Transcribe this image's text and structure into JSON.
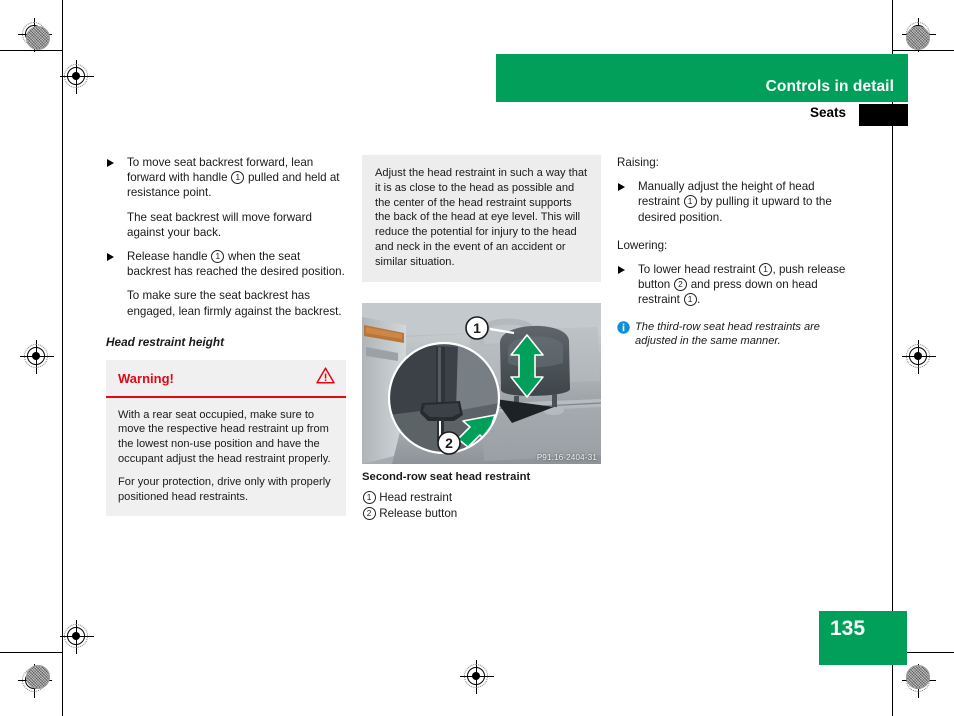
{
  "header": {
    "title": "Controls in detail",
    "section": "Seats"
  },
  "footer": {
    "page_number": "135"
  },
  "colors": {
    "brand_green": "#00a05a",
    "warning_red": "#e30613",
    "info_blue": "#0e8fd6",
    "note_gray": "#ededed",
    "warning_gray": "#f0f0f0"
  },
  "left_column": {
    "bullet1": "To move seat backrest forward, lean forward with handle ① pulled and held at resistance point.",
    "bullet1_pre": "To move seat backrest forward, lean forward with handle ",
    "bullet1_post": " pulled and held at resistance point.",
    "note1": "The seat backrest will move forward against your back.",
    "bullet2_pre": "Release handle ",
    "bullet2_post": " when the seat backrest has reached the desired position.",
    "note2": "To make sure the seat backrest has engaged, lean firmly against the backrest.",
    "subhead": "Head restraint height",
    "warning": {
      "label": "Warning!",
      "icon": "warning-triangle-icon",
      "paragraph1": "With a rear seat occupied, make sure to move the respective head restraint up from the lowest non-use position and have the occupant adjust the head restraint properly.",
      "paragraph2": "For your protection, drive only with properly positioned head restraints."
    }
  },
  "middle_column": {
    "note_box": "Adjust the head restraint in such a way that it is as close to the head as possible and the center of the head restraint supports the back of the head at eye level. This will reduce the potential for injury to the head and neck in the event of an accident or similar situation.",
    "figure": {
      "reference_code": "P91.16-2404-31",
      "callout_1": "1",
      "callout_2": "2",
      "caption": "Second-row seat head restraint",
      "legend": [
        {
          "num": "1",
          "label": "Head restraint"
        },
        {
          "num": "2",
          "label": "Release button"
        }
      ]
    }
  },
  "right_column": {
    "raising_label": "Raising:",
    "raising_bullet_pre": "Manually adjust the height of head restraint ",
    "raising_bullet_post": " by pulling it upward to the desired position.",
    "lowering_label": "Lowering:",
    "lowering_bullet_pre": "To lower head restraint ",
    "lowering_bullet_mid": ", push release button ",
    "lowering_bullet_post2": " and press down on head restraint ",
    "lowering_bullet_end": ".",
    "info_note": "The third-row seat head restraints are adjusted in the same manner.",
    "info_icon": "info-circle-icon"
  },
  "numbers": {
    "one": "1",
    "two": "2"
  }
}
